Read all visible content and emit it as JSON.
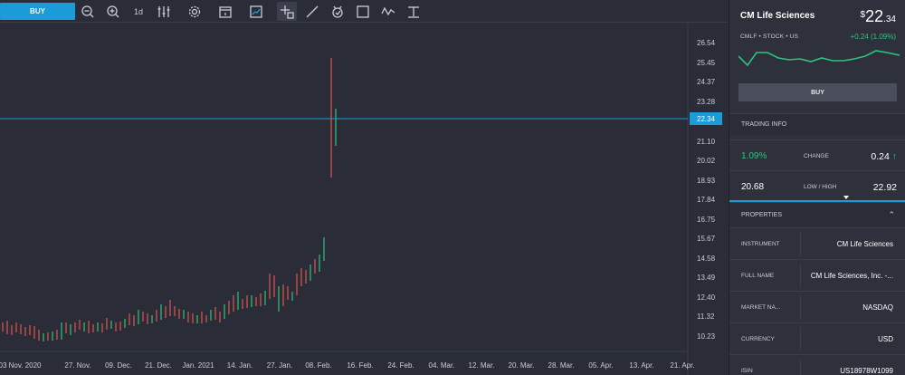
{
  "toolbar": {
    "buy_label": "BUY",
    "interval_label": "1d",
    "tools": [
      "zoom-out-icon",
      "zoom-in-icon",
      "interval",
      "indicators-icon",
      "settings-icon",
      "calendar-icon",
      "chart-type-icon",
      "crosshair-icon",
      "line-tool-icon",
      "magnet-icon",
      "rectangle-icon",
      "wave-icon",
      "text-tool-icon"
    ]
  },
  "chart_data": {
    "type": "candlestick",
    "price_axis": [
      "26.54",
      "25.45",
      "24.37",
      "23.28",
      "22.34",
      "21.10",
      "20.02",
      "18.93",
      "17.84",
      "16.75",
      "15.67",
      "14.58",
      "13.49",
      "12.40",
      "11.32",
      "10.23"
    ],
    "current_price_label": "22.34",
    "time_axis": [
      "03 Nov. 2020",
      "27. Nov.",
      "09. Dec.",
      "21. Dec.",
      "Jan. 2021",
      "14. Jan.",
      "27. Jan.",
      "08. Feb.",
      "16. Feb.",
      "24. Feb.",
      "04. Mar.",
      "12. Mar.",
      "20. Mar.",
      "28. Mar.",
      "05. Apr.",
      "13. Apr.",
      "21. Apr."
    ],
    "colors": {
      "up": "#2ec27e",
      "down": "#e0534f",
      "price_line": "#1b9bd8"
    }
  },
  "instrument": {
    "name": "CM Life Sciences",
    "price_currency": "$",
    "price_int": "22",
    "price_dec": ".34",
    "meta": "CMLF • STOCK • US",
    "change": "+0.24 (1.09%)",
    "buy_label": "BUY"
  },
  "trading_info": {
    "header": "TRADING INFO",
    "change_pct": "1.09%",
    "change_label": "CHANGE",
    "change_abs": "0.24",
    "low": "20.68",
    "lowhigh_label": "LOW / HIGH",
    "high": "22.92"
  },
  "properties": {
    "header": "PROPERTIES",
    "rows": [
      {
        "k": "INSTRUMENT",
        "v": "CM Life Sciences"
      },
      {
        "k": "FULL NAME",
        "v": "CM Life Sciences, Inc. -..."
      },
      {
        "k": "MARKET NA...",
        "v": "NASDAQ"
      },
      {
        "k": "CURRENCY",
        "v": "USD"
      },
      {
        "k": "ISIN",
        "v": "US18978W1099"
      }
    ]
  }
}
